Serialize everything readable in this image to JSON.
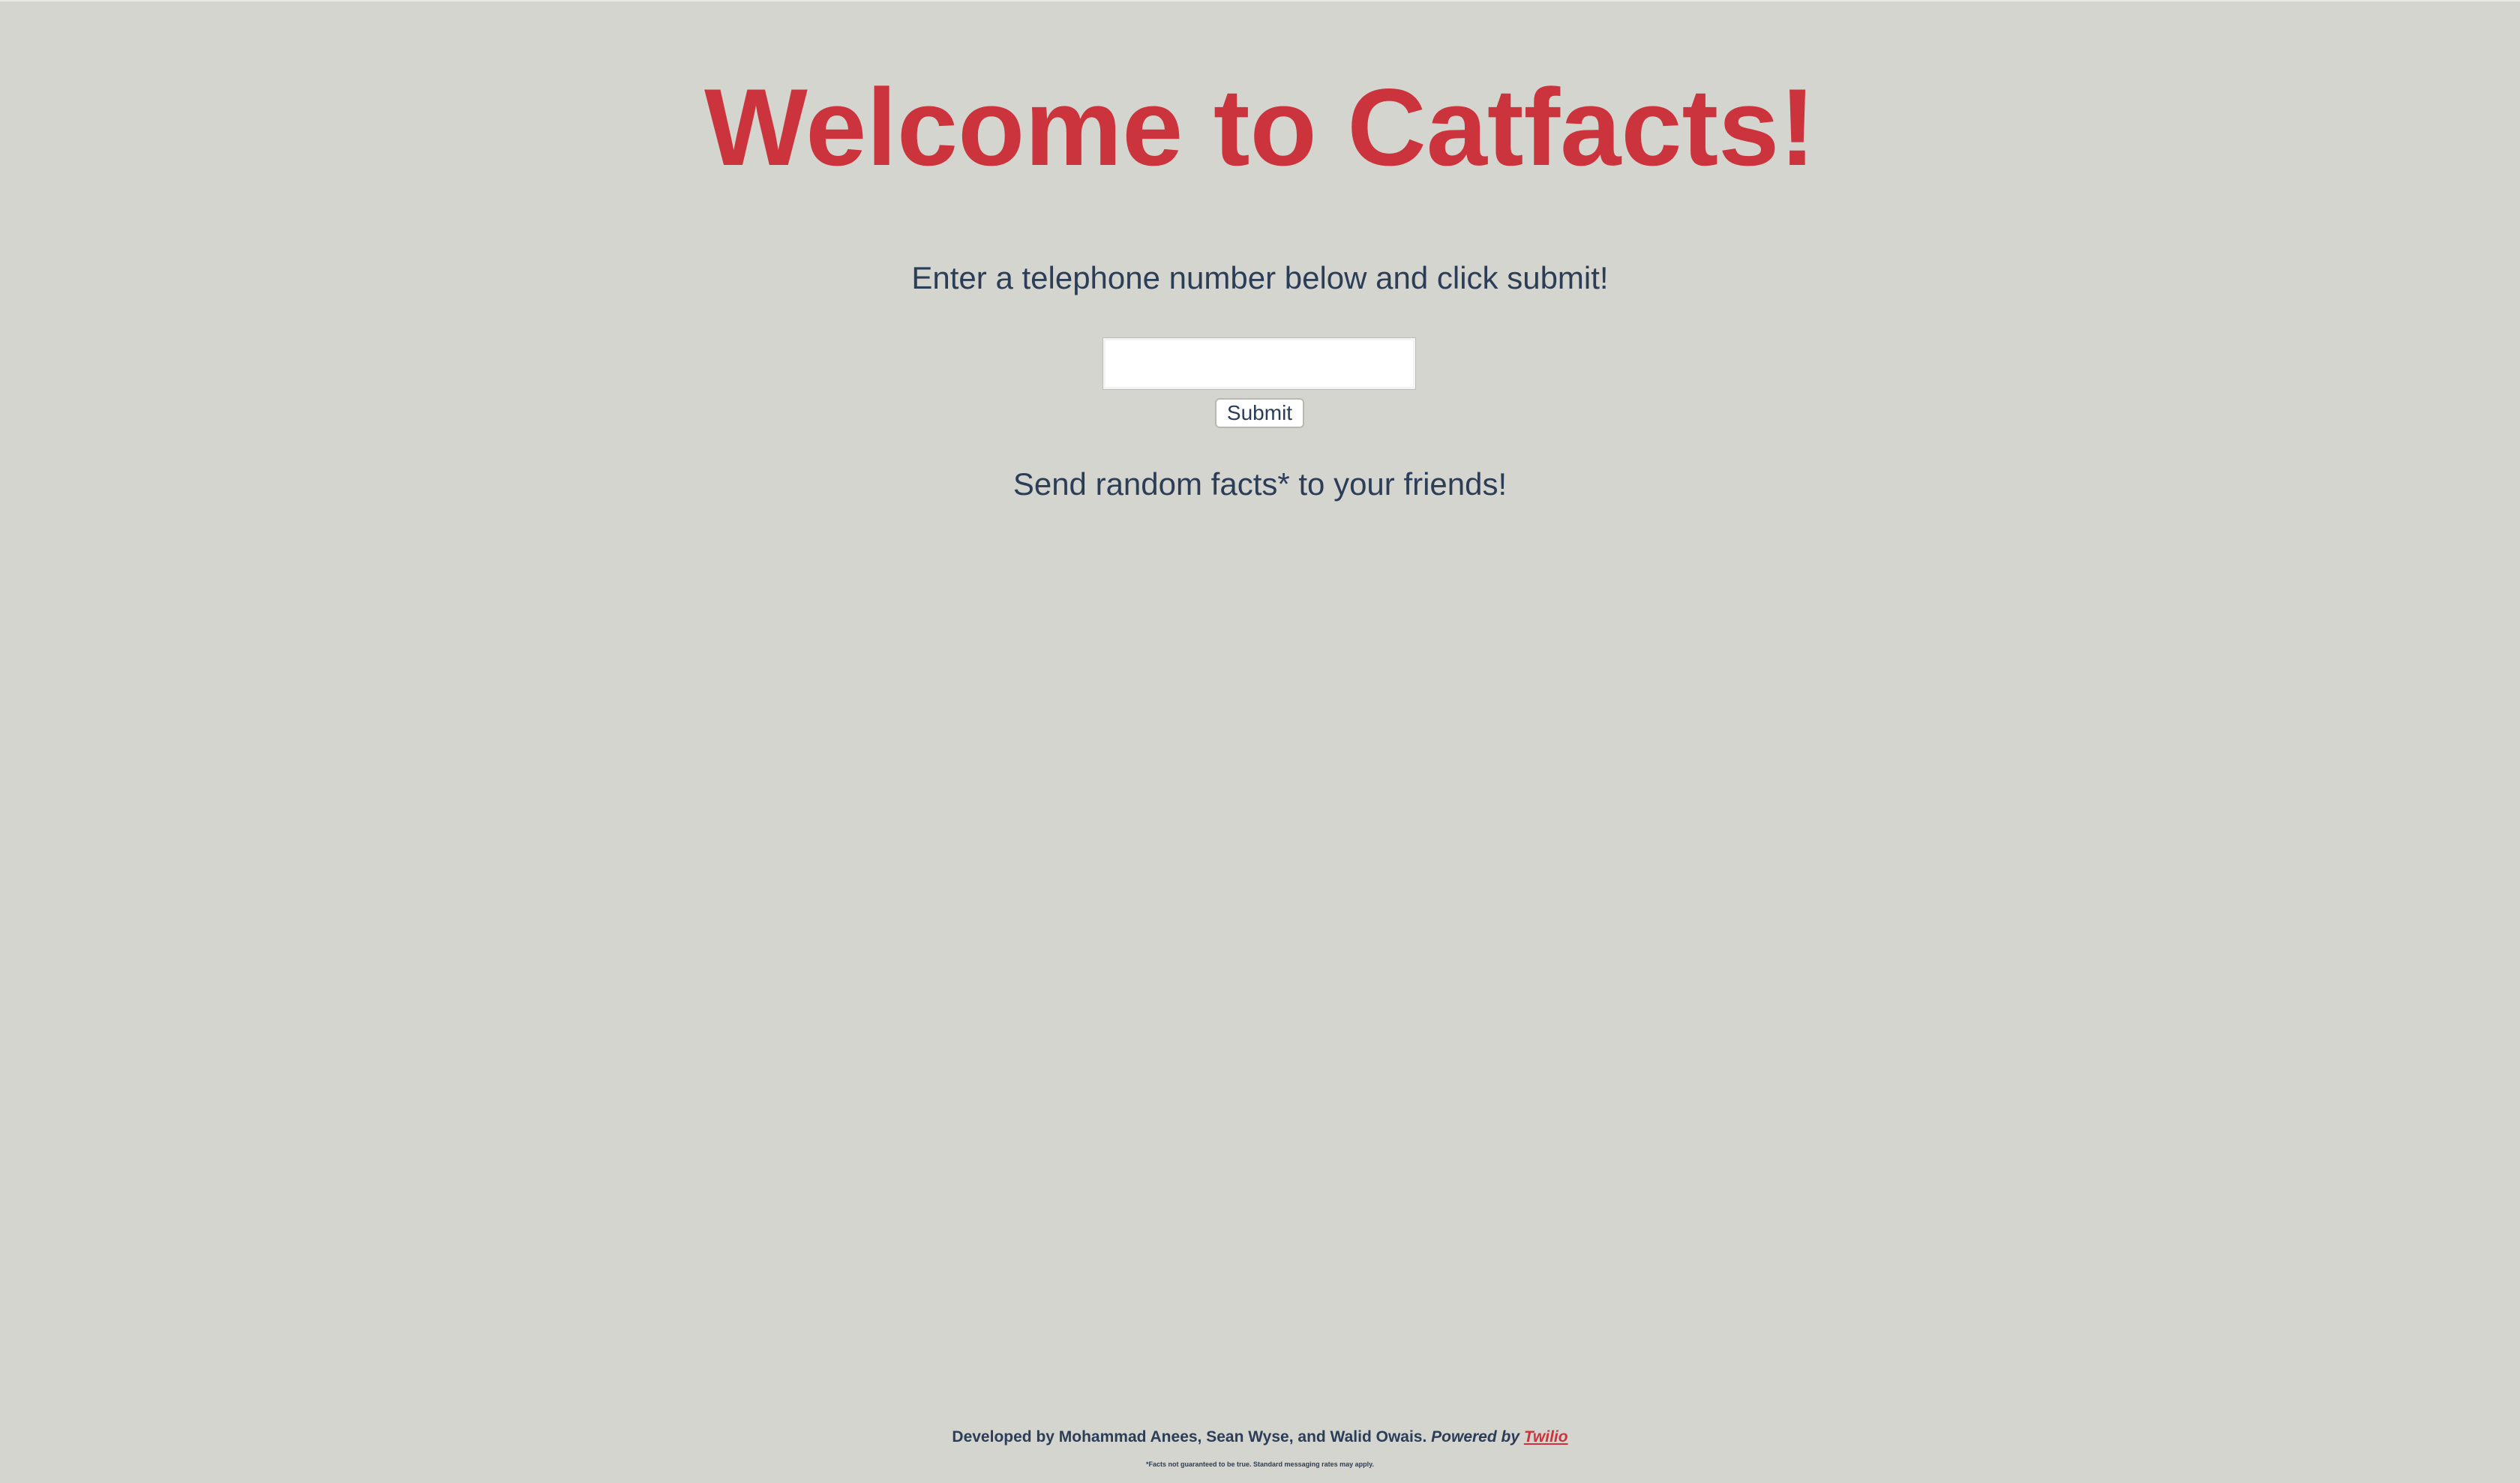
{
  "header": {
    "title": "Welcome to Catfacts!"
  },
  "form": {
    "instruction": "Enter a telephone number below and click submit!",
    "phone_value": "",
    "phone_placeholder": "",
    "submit_label": "Submit"
  },
  "tagline": "Send random facts* to your friends!",
  "footer": {
    "credits": "Developed by Mohammad Anees, Sean Wyse, and Walid Owais.",
    "powered_by": "Powered by",
    "powered_link": "Twilio",
    "disclaimer": "*Facts not guaranteed to be true. Standard messaging rates may apply."
  },
  "colors": {
    "background": "#d5d5cf",
    "accent": "#cc343d",
    "text": "#2c3e57"
  }
}
